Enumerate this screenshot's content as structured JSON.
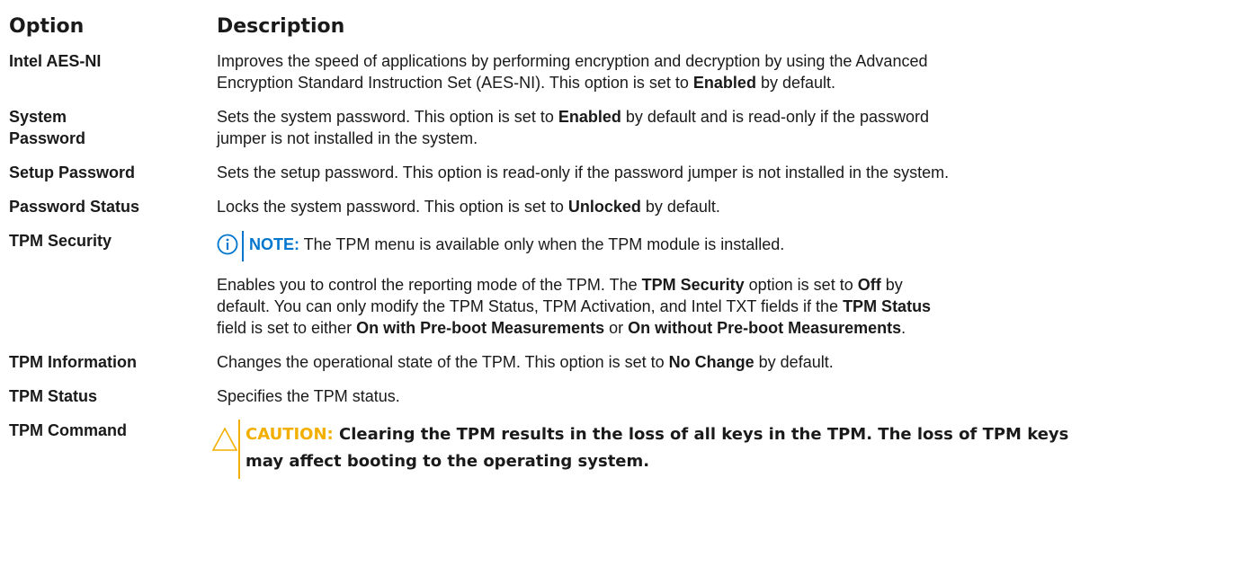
{
  "header": {
    "option": "Option",
    "description": "Description"
  },
  "rows": [
    {
      "option": "Intel AES-NI",
      "desc": {
        "l1": "Improves the speed of applications by performing encryption and decryption by using the Advanced",
        "l2a": "Encryption Standard Instruction Set (AES-NI). This option is set to ",
        "l2b": "Enabled",
        "l2c": " by default."
      }
    },
    {
      "option_l1": "System",
      "option_l2": "Password",
      "desc": {
        "l1a": "Sets the system password. This option is set to ",
        "l1b": "Enabled",
        "l1c": " by default and is read-only if the password",
        "l2": "jumper is not installed in the system."
      }
    },
    {
      "option": "Setup Password",
      "desc": {
        "l1": "Sets the setup password. This option is read-only if the password jumper is not installed in the system."
      }
    },
    {
      "option": "Password Status",
      "desc": {
        "l1a": "Locks the system password. This option is set to ",
        "l1b": "Unlocked",
        "l1c": " by default."
      }
    },
    {
      "option": "TPM Security",
      "note": {
        "label": "NOTE:",
        "text": " The TPM menu is available only when the TPM module is installed."
      },
      "desc": {
        "l1a": "Enables you to control the reporting mode of the TPM. The ",
        "l1b": "TPM Security",
        "l1c": " option is set to ",
        "l1d": "Off",
        "l1e": " by",
        "l2a": "default. You can only modify the TPM Status, TPM Activation, and Intel TXT fields if the ",
        "l2b": "TPM Status",
        "l3a": "field is set to either ",
        "l3b": "On with Pre-boot Measurements",
        "l3c": " or ",
        "l3d": "On without Pre-boot Measurements",
        "l3e": "."
      }
    },
    {
      "option": "TPM Information",
      "desc": {
        "l1a": "Changes the operational state of the TPM. This option is set to ",
        "l1b": "No Change",
        "l1c": " by default."
      }
    },
    {
      "option": "TPM Status",
      "desc": {
        "l1": "Specifies the TPM status."
      }
    },
    {
      "option": "TPM Command",
      "caution": {
        "label": "CAUTION:",
        "text_l1": " Clearing the TPM results in the loss of all keys in the TPM. The loss of TPM keys",
        "text_l2": "may affect booting to the operating system."
      }
    }
  ],
  "colors": {
    "note_blue": "#0076ce",
    "caution_yellow": "#f2af00",
    "text": "#1a1a1a"
  },
  "icons": {
    "note": "info-circle-icon",
    "caution": "warning-triangle-icon"
  }
}
